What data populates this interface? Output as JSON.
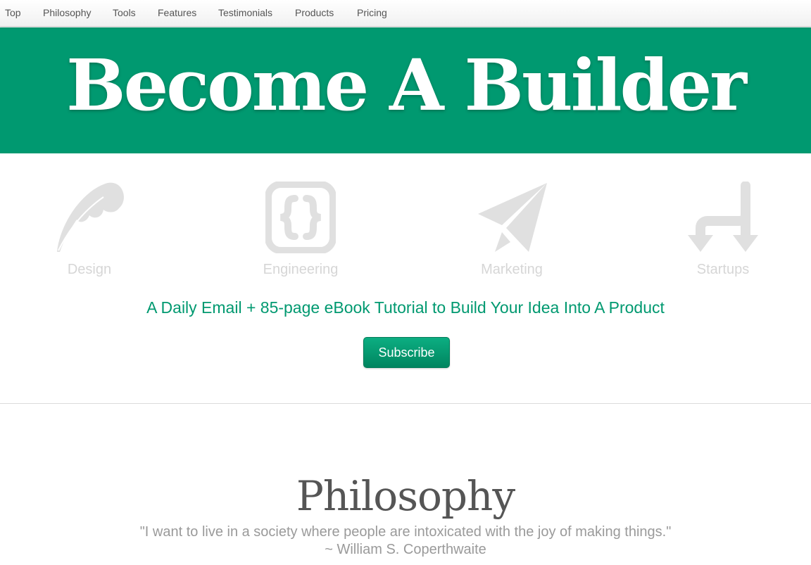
{
  "nav": {
    "items": [
      {
        "label": "Top"
      },
      {
        "label": "Philosophy"
      },
      {
        "label": "Tools"
      },
      {
        "label": "Features"
      },
      {
        "label": "Testimonials"
      },
      {
        "label": "Products"
      },
      {
        "label": "Pricing"
      }
    ]
  },
  "hero": {
    "title": "Become A Builder",
    "background_color": "#009970"
  },
  "features": [
    {
      "label": "Design",
      "icon": "feather-icon"
    },
    {
      "label": "Engineering",
      "icon": "code-braces-icon"
    },
    {
      "label": "Marketing",
      "icon": "paper-plane-icon"
    },
    {
      "label": "Startups",
      "icon": "split-arrows-icon"
    }
  ],
  "tagline": "A Daily Email + 85-page eBook Tutorial to Build Your Idea Into A Product",
  "subscribe_label": "Subscribe",
  "philosophy": {
    "title": "Philosophy",
    "quote": "\"I want to live in a society where people are intoxicated with the joy of making things.\"",
    "author": "~ William S. Coperthwaite"
  },
  "colors": {
    "accent": "#009970",
    "icon_gray": "#e0e0e0",
    "nav_text": "#555555"
  }
}
